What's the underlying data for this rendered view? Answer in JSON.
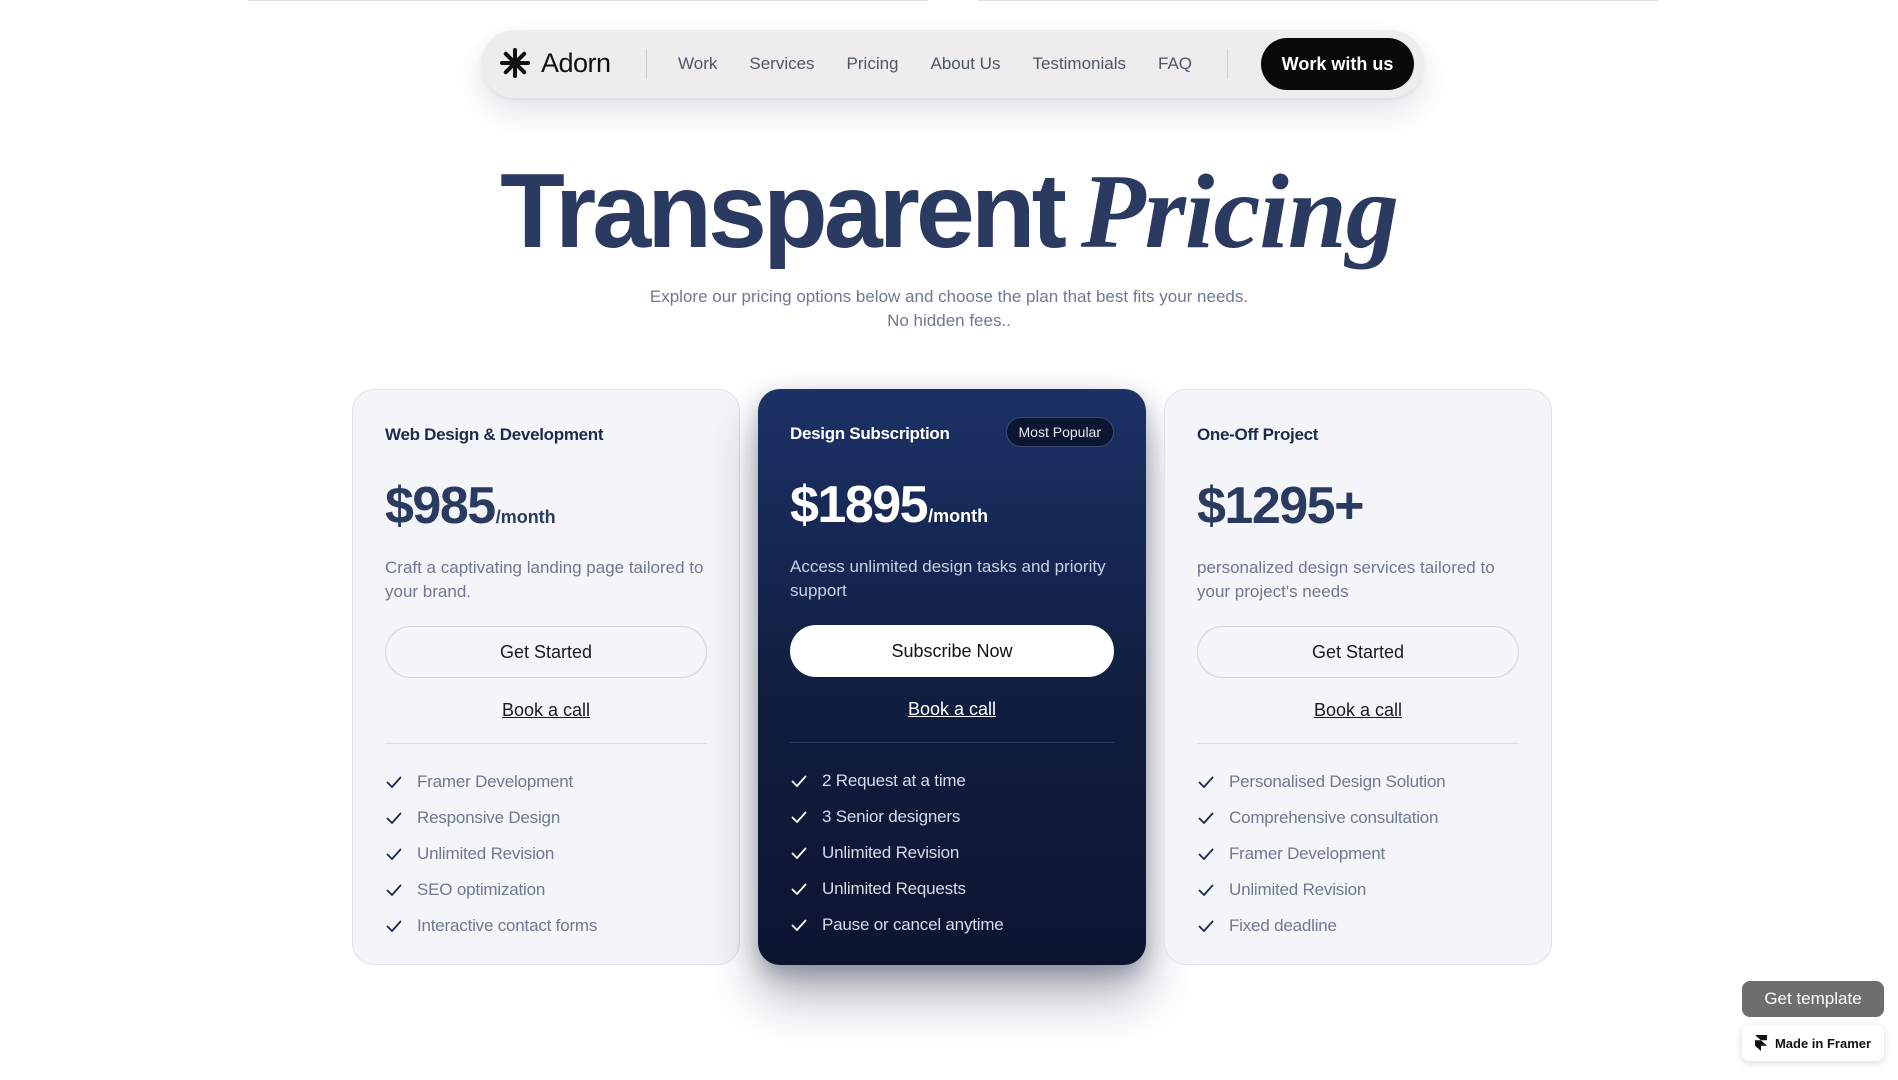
{
  "nav": {
    "brand": "Adorn",
    "links": [
      "Work",
      "Services",
      "Pricing",
      "About Us",
      "Testimonials",
      "FAQ"
    ],
    "cta": "Work with us"
  },
  "hero": {
    "title_part1": "Transparent",
    "title_part2": "Pricing",
    "subtitle_line1": "Explore our pricing options below and choose the plan that best fits your needs.",
    "subtitle_line2": "No hidden fees.."
  },
  "plans": [
    {
      "title": "Web Design & Development",
      "price": "$985",
      "per": "/month",
      "description": "Craft a captivating landing page tailored to your brand.",
      "button": "Get Started",
      "call": "Book a call",
      "features": [
        "Framer Development",
        "Responsive Design",
        "Unlimited Revision",
        "SEO optimization",
        "Interactive contact forms"
      ]
    },
    {
      "title": "Design Subscription",
      "badge": "Most Popular",
      "price": "$1895",
      "per": "/month",
      "description": "Access unlimited design tasks and priority support",
      "button": "Subscribe Now",
      "call": "Book a call",
      "features": [
        "2 Request at a time",
        "3 Senior designers",
        "Unlimited Revision",
        "Unlimited Requests",
        "Pause or cancel anytime"
      ]
    },
    {
      "title": "One-Off Project",
      "price": "$1295+",
      "per": "",
      "description": "personalized design services tailored to your project's needs",
      "button": "Get Started",
      "call": "Book a call",
      "features": [
        "Personalised Design Solution",
        "Comprehensive consultation",
        "Framer Development",
        "Unlimited Revision",
        "Fixed deadline"
      ]
    }
  ],
  "framer": {
    "get_template": "Get template",
    "made_in": "Made in Framer"
  },
  "colors": {
    "accent_dark": "#111d3f",
    "heading": "#2b3a60",
    "muted": "#6e7891"
  }
}
